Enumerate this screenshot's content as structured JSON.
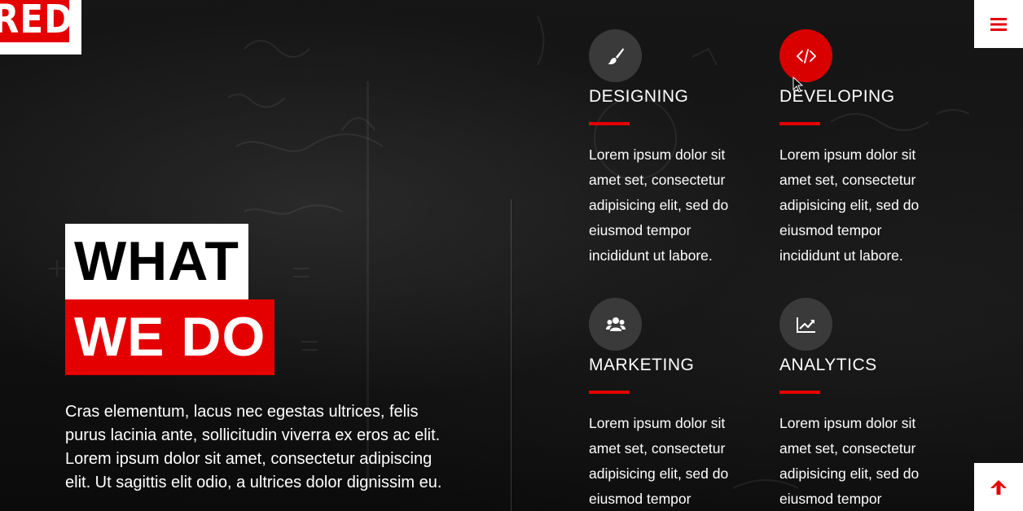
{
  "logo": {
    "text": "RED"
  },
  "header": {
    "menu_icon": "hamburger-icon"
  },
  "scroll_top": {
    "icon": "arrow-up-icon"
  },
  "heading": {
    "line1": "WHAT",
    "line2": "WE DO"
  },
  "intro": "Cras elementum, lacus nec egestas ultrices, felis purus lacinia ante, sollicitudin viverra ex eros ac elit. Lorem ipsum dolor sit amet, consectetur adipiscing elit. Ut sagittis elit odio, a ultrices dolor dignissim eu.",
  "services": [
    {
      "title": "DESIGNING",
      "icon": "paint-brush-icon",
      "active": false,
      "desc": "Lorem ipsum dolor sit amet set, consectetur adipisicing elit, sed do eiusmod tempor incididunt ut labore."
    },
    {
      "title": "DEVELOPING",
      "icon": "code-icon",
      "active": true,
      "desc": "Lorem ipsum dolor sit amet set, consectetur adipisicing elit, sed do eiusmod tempor incididunt ut labore."
    },
    {
      "title": "MARKETING",
      "icon": "users-icon",
      "active": false,
      "desc": "Lorem ipsum dolor sit amet set, consectetur adipisicing elit, sed do eiusmod tempor"
    },
    {
      "title": "ANALYTICS",
      "icon": "line-chart-icon",
      "active": false,
      "desc": "Lorem ipsum dolor sit amet set, consectetur adipisicing elit, sed do eiusmod tempor"
    }
  ],
  "colors": {
    "accent": "#e50000",
    "icon_bg": "#3a3a3a",
    "background": "#0d0d0d"
  }
}
